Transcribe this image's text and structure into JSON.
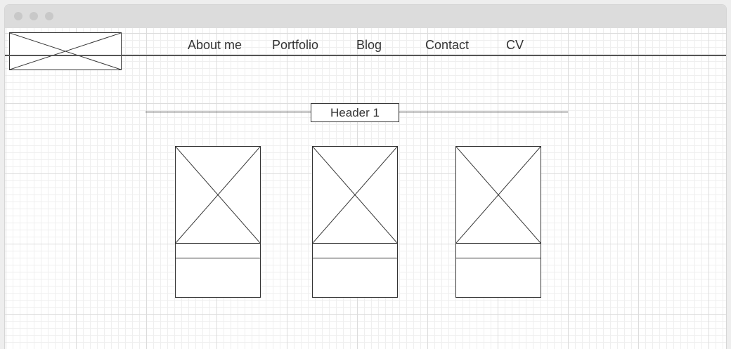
{
  "window": {
    "controls": [
      "close-dot",
      "minimize-dot",
      "zoom-dot"
    ]
  },
  "nav": {
    "items": [
      {
        "label": "About me"
      },
      {
        "label": "Portfolio"
      },
      {
        "label": "Blog"
      },
      {
        "label": "Contact"
      },
      {
        "label": "CV"
      }
    ]
  },
  "section": {
    "header": "Header 1"
  },
  "cards": [
    {
      "image": "image-placeholder"
    },
    {
      "image": "image-placeholder"
    },
    {
      "image": "image-placeholder"
    }
  ]
}
